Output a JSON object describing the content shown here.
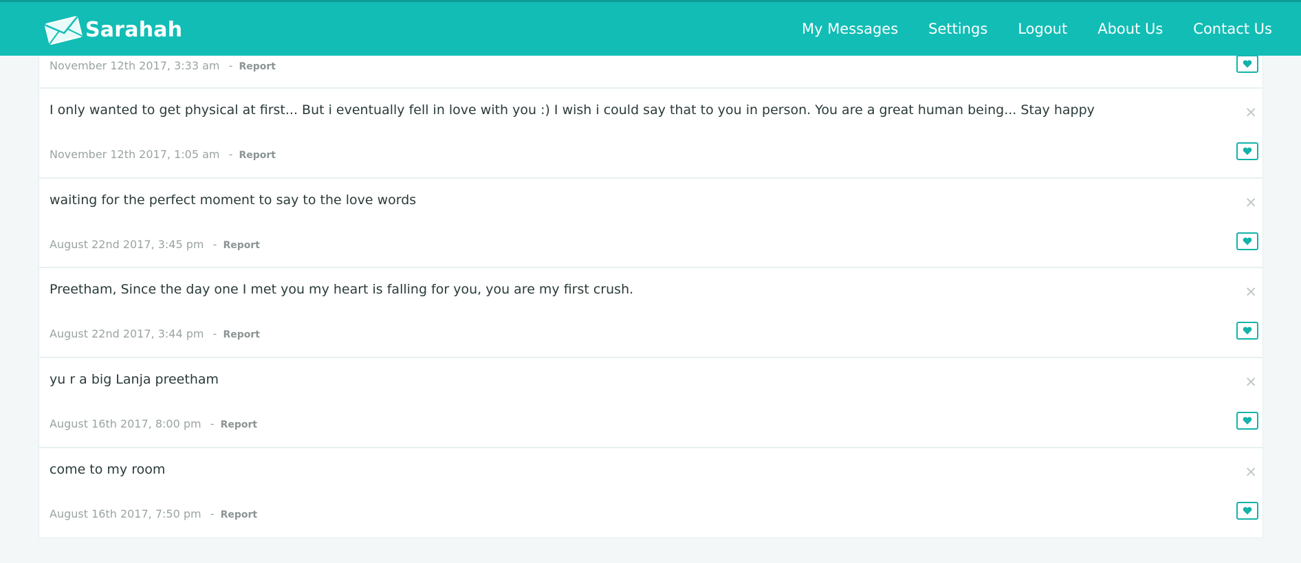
{
  "brand": {
    "name": "Sarahah",
    "icon": "envelope-icon"
  },
  "colors": {
    "accent": "#12bdb5",
    "heart": "#12b3ab",
    "background": "#f3f7f8"
  },
  "nav": {
    "items": [
      {
        "label": "My Messages"
      },
      {
        "label": "Settings"
      },
      {
        "label": "Logout"
      },
      {
        "label": "About Us"
      },
      {
        "label": "Contact Us"
      }
    ]
  },
  "messages": [
    {
      "text": "",
      "date": "November 12th 2017, 3:33 am",
      "report": "Report"
    },
    {
      "text": "I only wanted to get physical at first... But i eventually fell in love with you :) I wish i could say that to you in person. You are a great human being... Stay happy",
      "date": "November 12th 2017, 1:05 am",
      "report": "Report"
    },
    {
      "text": "waiting for the perfect moment to say to the love words",
      "date": "August 22nd 2017, 3:45 pm",
      "report": "Report"
    },
    {
      "text": "Preetham, Since the day one I met you my heart is falling for you, you are my first crush.",
      "date": "August 22nd 2017, 3:44 pm",
      "report": "Report"
    },
    {
      "text": "yu r a big Lanja preetham",
      "date": "August 16th 2017, 8:00 pm",
      "report": "Report"
    },
    {
      "text": "come to my room",
      "date": "August 16th 2017, 7:50 pm",
      "report": "Report"
    }
  ],
  "separator": "-"
}
